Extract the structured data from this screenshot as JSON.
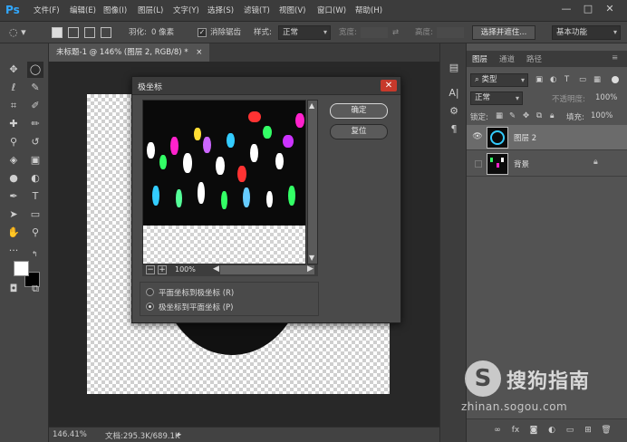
{
  "app": {
    "logo": "Ps",
    "accent": "#31a8ff"
  },
  "menu": [
    "文件(F)",
    "编辑(E)",
    "图像(I)",
    "图层(L)",
    "文字(Y)",
    "选择(S)",
    "滤镜(T)",
    "视图(V)",
    "窗口(W)",
    "帮助(H)"
  ],
  "window_controls": [
    "—",
    "□",
    "✕"
  ],
  "options": {
    "feather_label": "羽化:",
    "feather_value": "0 像素",
    "antialias_label": "消除锯齿",
    "style_label": "样式:",
    "style_value": "正常",
    "width_label": "宽度:",
    "height_label": "高度:",
    "select_mask_button": "选择并遮住...",
    "workspace": "基本功能"
  },
  "document_tab": {
    "title": "未标题-1 @ 146% (图层 2, RGB/8) *",
    "close": "×"
  },
  "dialog": {
    "title": "极坐标",
    "ok_button": "确定",
    "reset_button": "复位",
    "zoom": "100%",
    "option_1": "平面坐标到极坐标 (R)",
    "option_2": "极坐标到平面坐标 (P)",
    "selected_option": 2
  },
  "layers_panel": {
    "tabs": [
      "图层",
      "通道",
      "路径"
    ],
    "filter_kind": "类型",
    "blend_mode": "正常",
    "opacity_label": "不透明度:",
    "opacity_value": "100%",
    "lock_label": "锁定:",
    "fill_label": "填充:",
    "fill_value": "100%",
    "layers": [
      {
        "name": "图层 2",
        "visible": true,
        "selected": true
      },
      {
        "name": "背景",
        "visible": false,
        "selected": false,
        "locked": true
      }
    ]
  },
  "status": {
    "zoom": "146.41%",
    "doc_size": "文档:295.3K/689.1K"
  },
  "watermark": {
    "logo": "S",
    "text": "搜狗指南",
    "url": "zhinan.sogou.com"
  }
}
